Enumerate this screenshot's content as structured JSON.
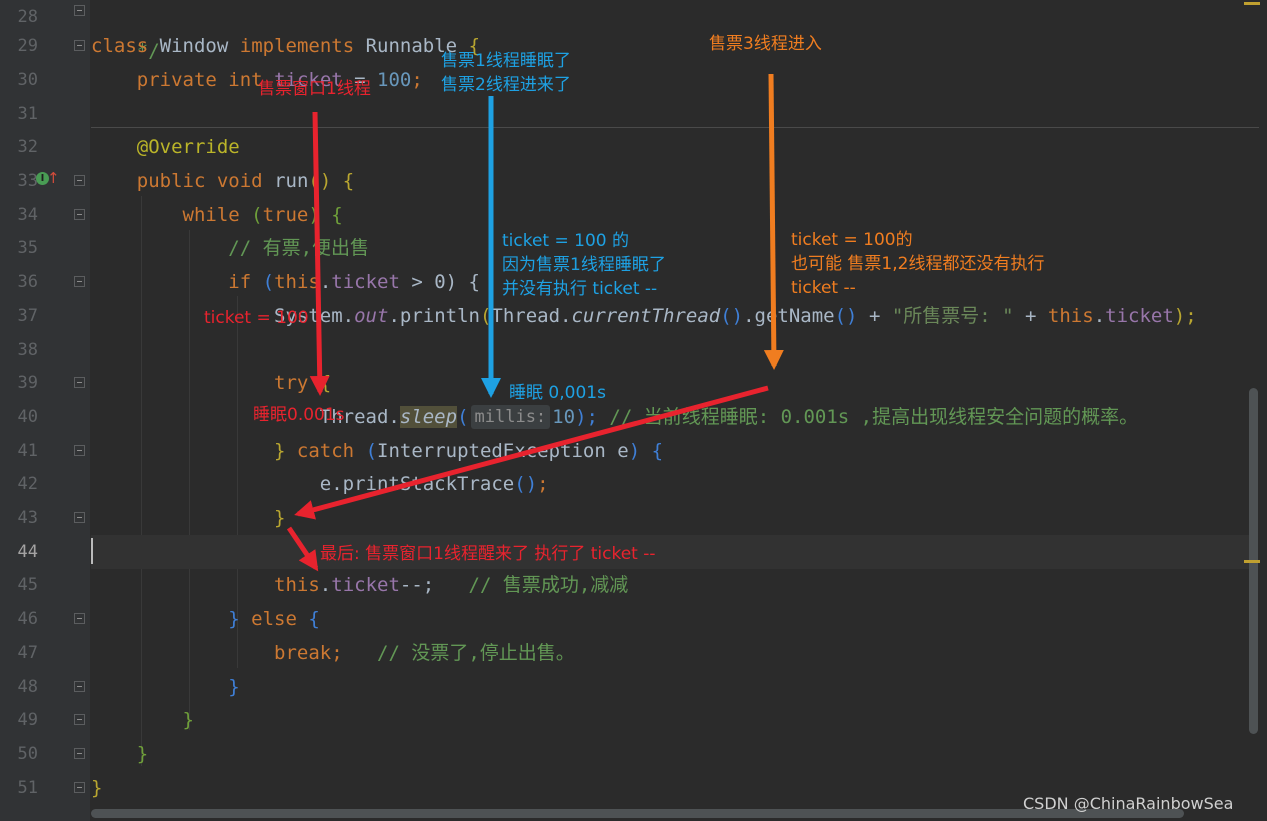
{
  "editor": {
    "line_numbers": [
      "28",
      "29",
      "30",
      "31",
      "32",
      "33",
      "34",
      "35",
      "36",
      "37",
      "38",
      "39",
      "40",
      "41",
      "42",
      "43",
      "44",
      "45",
      "46",
      "47",
      "48",
      "49",
      "50",
      "51"
    ],
    "current_line": "44",
    "code": {
      "l28": "*/",
      "l29_kw1": "class",
      "l29_name": "Window",
      "l29_kw2": "implements",
      "l29_iface": "Runnable",
      "l29_brace": "{",
      "l30_kw": "private int",
      "l30_field": "ticket",
      "l30_eq": " = ",
      "l30_num": "100",
      "l30_semi": ";",
      "l32_ann": "@Override",
      "l33_kw": "public void",
      "l33_name": "run",
      "l33_rest": "() {",
      "l34_kw": "while",
      "l34_open": " (",
      "l34_true": "true",
      "l34_rest": ") {",
      "l35_cmt": "// 有票,便出售",
      "l36_kw": "if",
      "l36_open": " (",
      "l36_this": "this",
      "l36_dot": ".",
      "l36_field": "ticket",
      "l36_rest": " > 0) {",
      "l37_sys": "System.",
      "l37_out": "out",
      "l37_println": ".println",
      "l37_p1": "(",
      "l37_thread": "Thread.",
      "l37_ct": "currentThread",
      "l37_p2": "()",
      "l37_gn": ".getName",
      "l37_p3": "()",
      "l37_plus": " + ",
      "l37_str": "\"所售票号: \"",
      "l37_plus2": " + ",
      "l37_this": "this",
      "l37_dot": ".",
      "l37_field": "ticket",
      "l37_end": ");",
      "l39_kw": "try",
      "l39_brace": " {",
      "l40_thread": "Thread.",
      "l40_sleep": "sleep",
      "l40_open": "(",
      "l40_hint": "millis:",
      "l40_num": "10",
      "l40_close": ");",
      "l40_cmt": " // 当前线程睡眠: 0.001s ,提高出现线程安全问题的概率。",
      "l41_brace": "} ",
      "l41_kw": "catch",
      "l41_open": " (",
      "l41_type": "InterruptedException e",
      "l41_rest": ") {",
      "l42": "e.printStackTrace",
      "l42_paren": "()",
      "l42_semi": ";",
      "l43": "}",
      "l45_this": "this",
      "l45_dot": ".",
      "l45_field": "ticket",
      "l45_rest": "--;",
      "l45_cmt": "   // 售票成功,减减",
      "l46_brace": "} ",
      "l46_kw": "else",
      "l46_brace2": " {",
      "l47_kw": "break",
      "l47_semi": ";",
      "l47_cmt": "   // 没票了,停止出售。",
      "l48": "}",
      "l49": "}",
      "l50": "}",
      "l51": "}"
    }
  },
  "annotations": {
    "red_window1": "售票窗口1线程",
    "red_ticket100": "ticket = 100",
    "red_sleep": "睡眠0.001s",
    "red_final": "最后: 售票窗口1线程醒来了 执行了 ticket --",
    "blue_top": "售票1线程睡眠了\n售票2线程进来了",
    "blue_mid": "ticket = 100 的\n因为售票1线程睡眠了\n并没有执行 ticket --",
    "blue_sleep": "睡眠 0,001s",
    "orange_top": "售票3线程进入",
    "orange_mid": "ticket = 100的\n也可能 售票1,2线程都还没有执行\nticket --"
  },
  "colors": {
    "red": "#e8232e",
    "blue": "#1ea1e3",
    "orange": "#f07d20"
  },
  "watermark": "CSDN @ChinaRainbowSea"
}
